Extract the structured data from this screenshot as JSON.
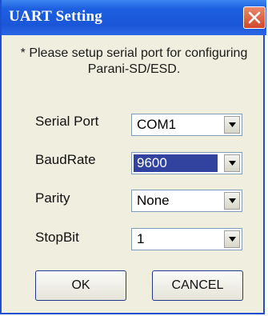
{
  "window": {
    "title": "UART Setting"
  },
  "instruction": "* Please setup serial port for configuring Parani-SD/ESD.",
  "fields": [
    {
      "label": "Serial Port",
      "value": "COM1"
    },
    {
      "label": "BaudRate",
      "value": "9600"
    },
    {
      "label": "Parity",
      "value": "None"
    },
    {
      "label": "StopBit",
      "value": "1"
    }
  ],
  "buttons": {
    "ok": "OK",
    "cancel": "CANCEL"
  },
  "icons": {
    "close": "close-icon",
    "dropdown": "chevron-down-icon"
  },
  "colors": {
    "titlebar": "#1a56d8",
    "dialog_bg": "#efeedf",
    "selection": "#31429f"
  }
}
